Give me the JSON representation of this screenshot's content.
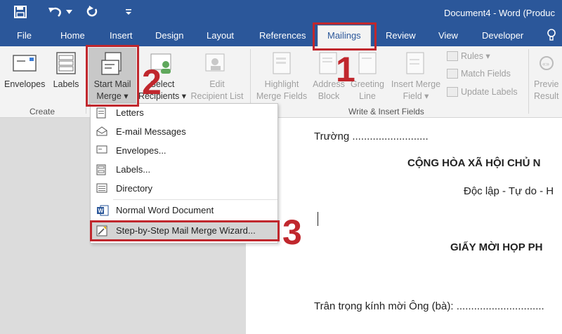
{
  "titlebar": {
    "document_title": "Document4 - Word (Produc"
  },
  "tabs": [
    {
      "label": "File"
    },
    {
      "label": "Home"
    },
    {
      "label": "Insert"
    },
    {
      "label": "Design"
    },
    {
      "label": "Layout"
    },
    {
      "label": "References"
    },
    {
      "label": "Mailings"
    },
    {
      "label": "Review"
    },
    {
      "label": "View"
    },
    {
      "label": "Developer"
    }
  ],
  "ribbon": {
    "create": {
      "group_label": "Create",
      "envelopes": "Envelopes",
      "labels": "Labels"
    },
    "start_mail_merge": {
      "line1": "Start Mail",
      "line2": "Merge ▾"
    },
    "select_recipients": {
      "line1": "Select",
      "line2": "Recipients ▾"
    },
    "edit_recipient_list": {
      "line1": "Edit",
      "line2": "Recipient List"
    },
    "write_insert": {
      "group_label": "Write & Insert Fields",
      "highlight": {
        "line1": "Highlight",
        "line2": "Merge Fields"
      },
      "address_block": {
        "line1": "Address",
        "line2": "Block"
      },
      "greeting_line": {
        "line1": "Greeting",
        "line2": "Line"
      },
      "insert_merge_field": {
        "line1": "Insert Merge",
        "line2": "Field ▾"
      },
      "rules": "Rules ▾",
      "match_fields": "Match Fields",
      "update_labels": "Update Labels"
    },
    "preview": {
      "line1": "Previe",
      "line2": "Result"
    }
  },
  "menu": {
    "items": [
      {
        "label": "Letters"
      },
      {
        "label": "E-mail Messages"
      },
      {
        "label": "Envelopes..."
      },
      {
        "label": "Labels..."
      },
      {
        "label": "Directory"
      },
      {
        "label": "Normal Word Document"
      },
      {
        "label": "Step-by-Step Mail Merge Wizard..."
      }
    ]
  },
  "annotations": {
    "step1": "1",
    "step2": "2",
    "step3": "3"
  },
  "document": {
    "line1": "Trường ..........................",
    "line2": "CỘNG HÒA XÃ HỘI CHỦ N",
    "line3": "Độc lập - Tự do - H",
    "line4": "GIẤY MỜI HỌP PH",
    "line5": "Trân trọng kính mời Ông (bà): .............................."
  },
  "colors": {
    "word_blue": "#2b579a",
    "annotation_red": "#c0272d"
  }
}
